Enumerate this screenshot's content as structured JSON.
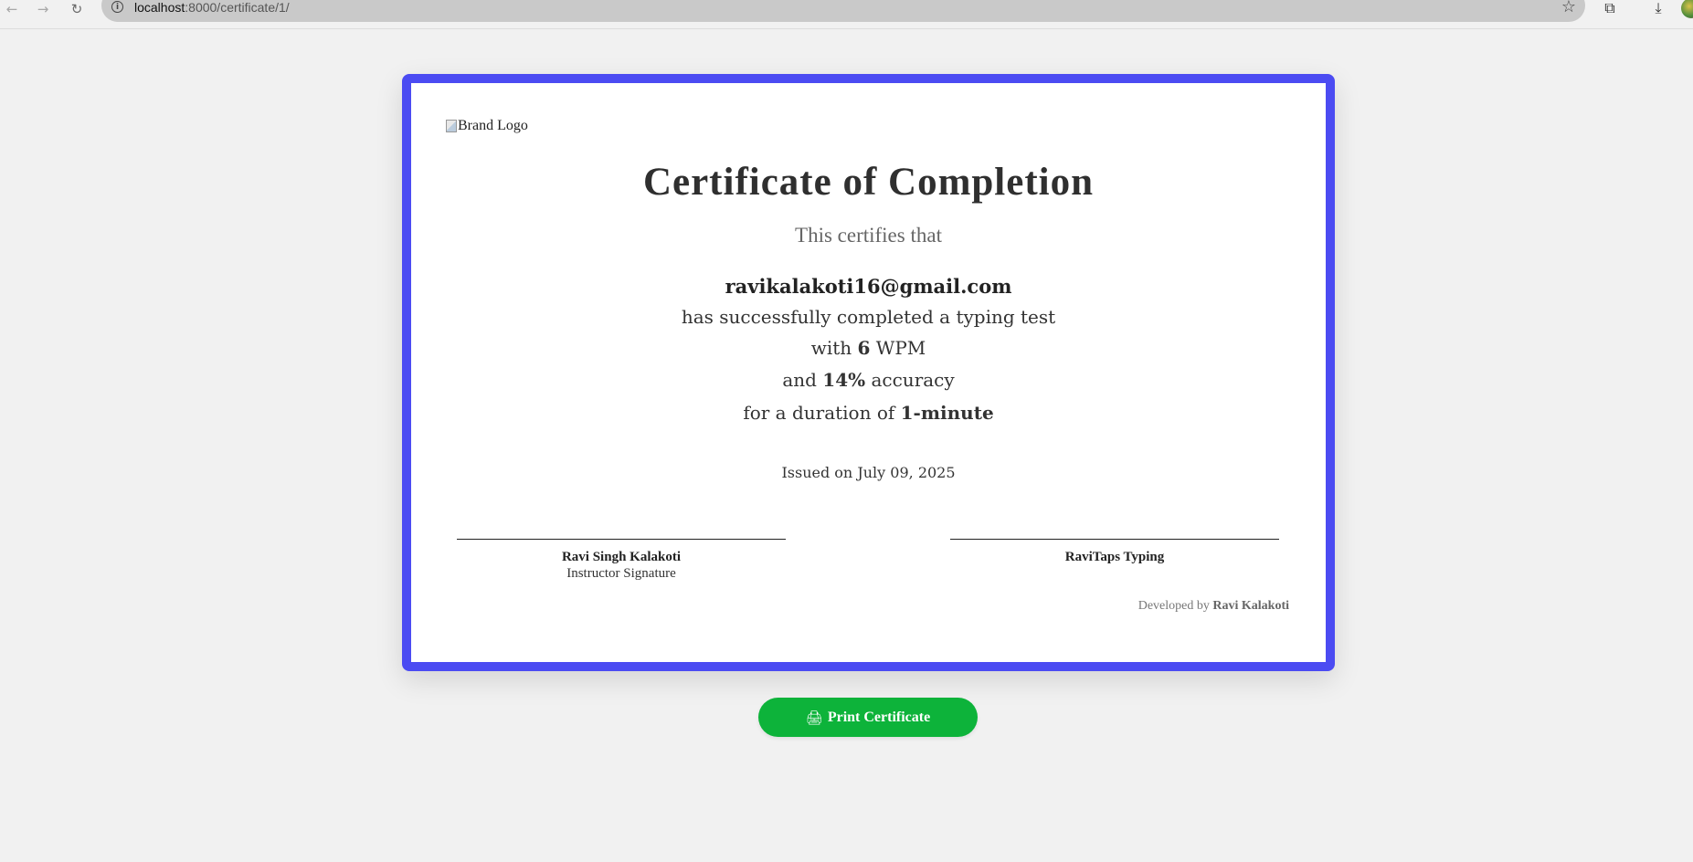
{
  "browser": {
    "url_host": "localhost",
    "url_path": ":8000/certificate/1/",
    "icons": [
      "back-icon",
      "forward-icon",
      "reload-icon",
      "info-icon",
      "star-icon",
      "extensions-icon",
      "download-icon"
    ]
  },
  "certificate": {
    "logo_alt": "Brand Logo",
    "title": "Certificate of Completion",
    "subtitle": "This certifies that",
    "recipient": "ravikalakoti16@gmail.com",
    "line_completed": "has successfully completed a typing test",
    "wpm_prefix": "with",
    "wpm_value": "6",
    "wpm_suffix": "WPM",
    "accuracy_prefix": "and",
    "accuracy_value": "14%",
    "accuracy_suffix": "accuracy",
    "duration_prefix": "for a duration of",
    "duration_value": "1-minute",
    "issued": "Issued on July 09, 2025",
    "signature_left_name": "Ravi Singh Kalakoti",
    "signature_left_role": "Instructor Signature",
    "signature_right_name": "RaviTaps Typing",
    "developed_by_prefix": "Developed by",
    "developed_by_name": "Ravi Kalakoti",
    "border_color": "#4b4bf2"
  },
  "actions": {
    "print_label": "Print Certificate",
    "print_color": "#0db33a"
  }
}
